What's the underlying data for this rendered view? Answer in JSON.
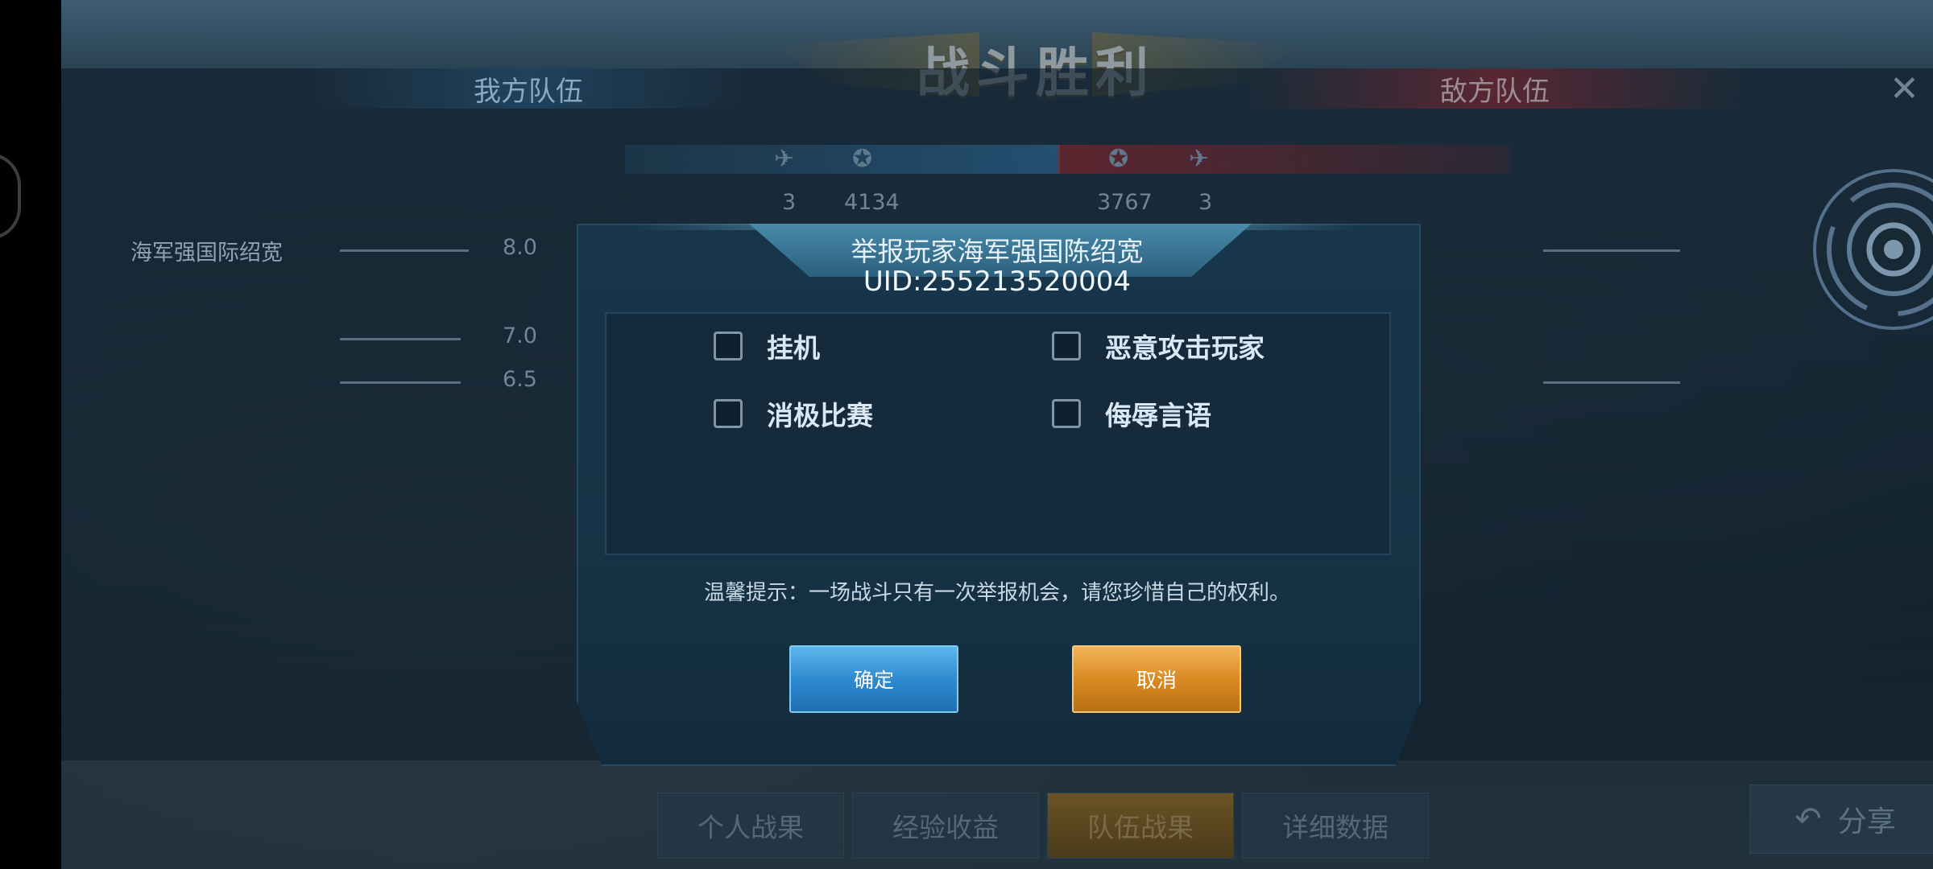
{
  "header": {
    "victory_title": "战斗胜利",
    "ally_team": "我方队伍",
    "enemy_team": "敌方队伍",
    "close_icon": "close-icon"
  },
  "background_rows": {
    "ally_score": "3",
    "ally_points": "4134",
    "enemy_points": "3767",
    "enemy_score": "3",
    "ally_player_name": "海军强国际绍宽",
    "ally_player_rating": "8.0",
    "row2_rating": "7.0",
    "row3_rating": "6.5"
  },
  "dialog": {
    "title": "举报玩家海军强国陈绍宽",
    "uid": "UID:255213520004",
    "options": [
      {
        "label": "挂机",
        "checked": false
      },
      {
        "label": "恶意攻击玩家",
        "checked": false
      },
      {
        "label": "消极比赛",
        "checked": false
      },
      {
        "label": "侮辱言语",
        "checked": false
      }
    ],
    "hint": "温馨提示：一场战斗只有一次举报机会，请您珍惜自己的权利。",
    "confirm_label": "确定",
    "cancel_label": "取消"
  },
  "bottom_tabs": [
    {
      "label": "个人战果",
      "active": false
    },
    {
      "label": "经验收益",
      "active": false
    },
    {
      "label": "队伍战果",
      "active": true
    },
    {
      "label": "详细数据",
      "active": false
    }
  ],
  "share_label": "分享",
  "colors": {
    "confirm": "#2f8bd0",
    "cancel": "#d98b22",
    "dialog_bg": "#163245"
  }
}
